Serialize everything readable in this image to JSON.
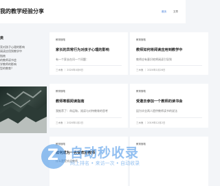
{
  "header": {
    "site_title": "我的教学经验分享",
    "nav": [
      "首页",
      "文章"
    ]
  },
  "sidebar": {
    "title": "类",
    "items": [
      "亮对孩子心理的影响",
      "阅读应用到教学中",
      "指南",
      "的教师读书会",
      "学教师的影响",
      "型的教育？"
    ]
  },
  "cards": [
    {
      "tag": "教育随笔",
      "title": "家长的异常行为对孩子心理的影响",
      "excerpt": "有一个家长在问一个问题：",
      "meta": "三木鱼 ｜ 2020年4月6日"
    },
    {
      "tag": "教育随笔",
      "title": "教师如何将阅读应用到教学中",
      "excerpt": "教师应有意识地将阅读引导到",
      "meta": "三木鱼 ｜ 2020年1月28日"
    },
    {
      "tag": "教育随笔",
      "title": "教师寒假阅读指南",
      "excerpt": "我推荐了：命运和，阅读与对待教育的思考",
      "meta": "三木鱼 ｜ 2020年1月2日"
    },
    {
      "tag": "教育随笔",
      "title": "受邀去参加一个教师的读书会",
      "excerpt": "因为毕业两人提供教师读书的说法",
      "meta": "三木鱼 ｜ 2019年12月2日"
    },
    {
      "tag": "教育随笔",
      "title": "如何成为一名受欢迎教师",
      "excerpt": "什么是受欢迎教师",
      "meta": ""
    },
    {
      "tag": "教育随笔",
      "title": "",
      "excerpt": "",
      "meta": ""
    }
  ],
  "watermark": {
    "logo_letter": "Z",
    "title": "自动秒收录",
    "subtitle": "网上排名 • 来访一次 • 自动收录"
  }
}
